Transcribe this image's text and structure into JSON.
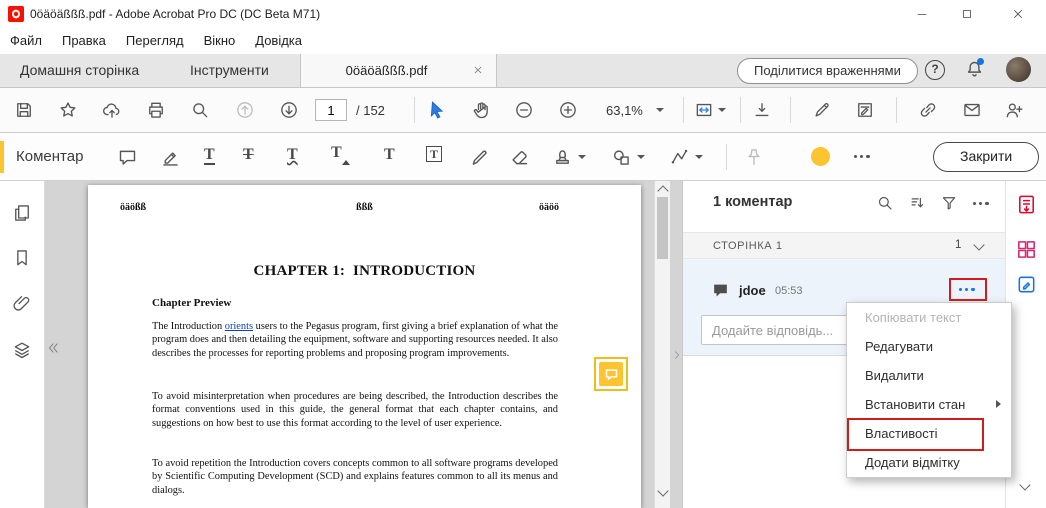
{
  "window": {
    "title": "0öäöäßßß.pdf - Adobe Acrobat Pro DC (DC Beta M71)",
    "menu": [
      "Файл",
      "Правка",
      "Перегляд",
      "Вікно",
      "Довідка"
    ]
  },
  "tabbar": {
    "home": "Домашня сторінка",
    "tools": "Інструменти",
    "document_tab": "0öäöäßßß.pdf",
    "share_button": "Поділитися враженнями",
    "help_glyph": "?"
  },
  "toolbar": {
    "page_current": "1",
    "page_total": "/ 152",
    "zoom_value": "63,1%"
  },
  "comment_bar": {
    "label": "Коментар",
    "close_button": "Закрити",
    "tool_glyph": "T"
  },
  "document": {
    "header_left": "öäößß",
    "header_center": "ßßß",
    "header_right": "öäöö",
    "chapter_title": "CHAPTER 1:  INTRODUCTION",
    "section_heading": "Chapter Preview",
    "para1_before": "The Introduction ",
    "para1_link": "orients",
    "para1_after": " users to the Pegasus program, first giving a brief explanation of what the program does and then detailing the equipment, software and supporting resources needed.  It also describes the processes for reporting problems and proposing program improvements.",
    "para2": "To avoid misinterpretation when procedures are being described, the Introduction describes the format conventions used in this guide, the general format that each chapter contains, and suggestions on how best to use this format according to the level of user experience.",
    "para3": "To avoid repetition the Introduction covers concepts common to all software programs developed by Scientific Computing Development (SCD) and explains features common to all its menus and dialogs."
  },
  "comments_panel": {
    "header": "1 коментар",
    "page_section_label": "СТОРІНКА 1",
    "page_section_count": "1",
    "comment": {
      "author": "jdoe",
      "time": "05:53",
      "reply_placeholder": "Додайте відповідь..."
    }
  },
  "context_menu": {
    "items": [
      {
        "label": "Копіювати текст"
      },
      {
        "label": "Редагувати"
      },
      {
        "label": "Видалити"
      },
      {
        "label": "Встановити стан"
      },
      {
        "label": "Властивості"
      },
      {
        "label": "Додати відмітку"
      }
    ]
  },
  "colors": {
    "accent_yellow": "#fdc431",
    "annotation_red": "#cf1d1d",
    "link_blue": "#0b43bd",
    "cursor_blue": "#2a7de1"
  }
}
